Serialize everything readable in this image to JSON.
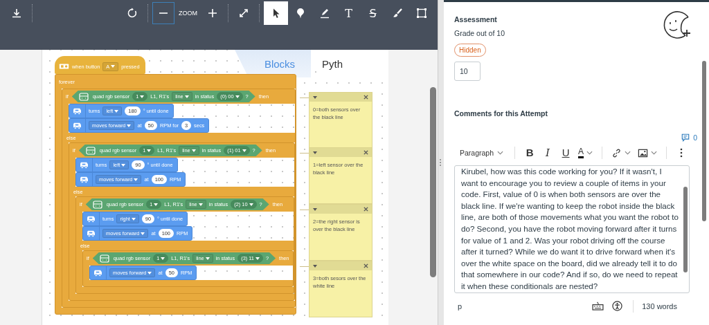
{
  "toolbar": {
    "zoom": {
      "label": "ZOOM",
      "out_focused": true
    },
    "tools": [
      {
        "kind": "pointer",
        "selected": true
      },
      {
        "kind": "pin",
        "selected": false
      },
      {
        "kind": "highlighter",
        "selected": false
      },
      {
        "kind": "text",
        "label": "T",
        "selected": false
      },
      {
        "kind": "strike",
        "label": "S",
        "selected": false
      },
      {
        "kind": "brush",
        "selected": false
      },
      {
        "kind": "area",
        "selected": false
      }
    ]
  },
  "editor_tabs": [
    {
      "label": "Blocks",
      "selected": true
    },
    {
      "label": "Pyth",
      "selected": false
    }
  ],
  "program": {
    "hat": [
      {
        "kind": "label",
        "text": "when button"
      },
      {
        "kind": "dropdown",
        "text": "A"
      },
      {
        "kind": "label",
        "text": "pressed"
      }
    ],
    "loop_label": "forever",
    "body": [
      {
        "kind": "if",
        "if_label": "if",
        "then_label": "then",
        "else_label": "else",
        "condition": [
          {
            "kind": "label",
            "text": "quad rgb sensor"
          },
          {
            "kind": "round",
            "text": "1"
          },
          {
            "kind": "label",
            "text": "L1, R1's"
          },
          {
            "kind": "dropdown",
            "text": "line"
          },
          {
            "kind": "label",
            "text": "in status"
          },
          {
            "kind": "round",
            "text": "(0) 00"
          },
          {
            "kind": "label",
            "text": "?"
          }
        ],
        "then": [
          {
            "kind": "statement",
            "parts": [
              {
                "kind": "label",
                "text": "turns"
              },
              {
                "kind": "dropdown",
                "text": "left"
              },
              {
                "kind": "number",
                "text": "180"
              },
              {
                "kind": "label",
                "text": "° until done"
              }
            ]
          },
          {
            "kind": "statement",
            "parts": [
              {
                "kind": "dropdown",
                "text": "moves forward"
              },
              {
                "kind": "label",
                "text": "at"
              },
              {
                "kind": "number",
                "text": "50"
              },
              {
                "kind": "label",
                "text": "RPM for"
              },
              {
                "kind": "number",
                "text": "3"
              },
              {
                "kind": "label",
                "text": "secs"
              }
            ]
          }
        ],
        "else": [
          {
            "kind": "if",
            "if_label": "if",
            "then_label": "then",
            "else_label": "else",
            "condition": [
              {
                "kind": "label",
                "text": "quad rgb sensor"
              },
              {
                "kind": "round",
                "text": "1"
              },
              {
                "kind": "label",
                "text": "L1, R1's"
              },
              {
                "kind": "dropdown",
                "text": "line"
              },
              {
                "kind": "label",
                "text": "in status"
              },
              {
                "kind": "round",
                "text": "(1) 01"
              },
              {
                "kind": "label",
                "text": "?"
              }
            ],
            "then": [
              {
                "kind": "statement",
                "parts": [
                  {
                    "kind": "label",
                    "text": "turns"
                  },
                  {
                    "kind": "dropdown",
                    "text": "left"
                  },
                  {
                    "kind": "number",
                    "text": "90"
                  },
                  {
                    "kind": "label",
                    "text": "° until done"
                  }
                ]
              },
              {
                "kind": "statement",
                "parts": [
                  {
                    "kind": "dropdown",
                    "text": "moves forward"
                  },
                  {
                    "kind": "label",
                    "text": "at"
                  },
                  {
                    "kind": "number",
                    "text": "100"
                  },
                  {
                    "kind": "label",
                    "text": "RPM"
                  }
                ]
              }
            ],
            "else": [
              {
                "kind": "if",
                "if_label": "if",
                "then_label": "then",
                "else_label": "else",
                "condition": [
                  {
                    "kind": "label",
                    "text": "quad rgb sensor"
                  },
                  {
                    "kind": "round",
                    "text": "1"
                  },
                  {
                    "kind": "label",
                    "text": "L1, R1's"
                  },
                  {
                    "kind": "dropdown",
                    "text": "line"
                  },
                  {
                    "kind": "label",
                    "text": "in status"
                  },
                  {
                    "kind": "round",
                    "text": "(2) 10"
                  },
                  {
                    "kind": "label",
                    "text": "?"
                  }
                ],
                "then": [
                  {
                    "kind": "statement",
                    "parts": [
                      {
                        "kind": "label",
                        "text": "turns"
                      },
                      {
                        "kind": "dropdown",
                        "text": "right"
                      },
                      {
                        "kind": "number",
                        "text": "90"
                      },
                      {
                        "kind": "label",
                        "text": "° until done"
                      }
                    ]
                  },
                  {
                    "kind": "statement",
                    "parts": [
                      {
                        "kind": "dropdown",
                        "text": "moves forward"
                      },
                      {
                        "kind": "label",
                        "text": "at"
                      },
                      {
                        "kind": "number",
                        "text": "100"
                      },
                      {
                        "kind": "label",
                        "text": "RPM"
                      }
                    ]
                  }
                ],
                "else": [
                  {
                    "kind": "if",
                    "if_label": "if",
                    "then_label": "then",
                    "condition": [
                      {
                        "kind": "label",
                        "text": "quad rgb sensor"
                      },
                      {
                        "kind": "round",
                        "text": "1"
                      },
                      {
                        "kind": "label",
                        "text": "L1, R1's"
                      },
                      {
                        "kind": "dropdown",
                        "text": "line"
                      },
                      {
                        "kind": "label",
                        "text": "in status"
                      },
                      {
                        "kind": "round",
                        "text": "(3) 11"
                      },
                      {
                        "kind": "label",
                        "text": "?"
                      }
                    ],
                    "then": [
                      {
                        "kind": "statement",
                        "parts": [
                          {
                            "kind": "dropdown",
                            "text": "moves forward"
                          },
                          {
                            "kind": "label",
                            "text": "at"
                          },
                          {
                            "kind": "number",
                            "text": "50"
                          },
                          {
                            "kind": "label",
                            "text": "RPM"
                          }
                        ]
                      }
                    ]
                  }
                ]
              }
            ]
          }
        ]
      }
    ]
  },
  "notes": [
    {
      "text": "0=both sensors over the black line"
    },
    {
      "text": "1=left sensor over the black line"
    },
    {
      "text": "2=the right sensor is over the black line"
    },
    {
      "text": "3=both sesors over the white line"
    }
  ],
  "assessment": {
    "heading": "Assessment",
    "grade_label": "Grade out of 10",
    "status": "Hidden",
    "grade": "10"
  },
  "comments": {
    "heading": "Comments for this Attempt",
    "count": "0",
    "block_style": "Paragraph",
    "format_buttons": [
      {
        "kind": "bold",
        "label": "B"
      },
      {
        "kind": "italic",
        "label": "I"
      },
      {
        "kind": "underline",
        "label": "U"
      },
      {
        "kind": "color",
        "label": "A"
      }
    ],
    "text": "Kirubel, how was this code working for you? If it wasn't, I want to encourage you to review a couple of items in your code. First, value of 0 is when both sensors are over the black line. If we're wanting to keep the robot inside the black line, are both of those movements what you want the robot to do? Second, you have the robot moving forward after it turns for value of 1 and 2. Was your robot driving off the course after it turned? While we do want it to drive forward when it's over the white space on the board, did we already tell it to do that somewhere in our code? And if so, do we need to repeat it when these conditionals are nested?",
    "path": "p",
    "word_count": "130 words"
  }
}
